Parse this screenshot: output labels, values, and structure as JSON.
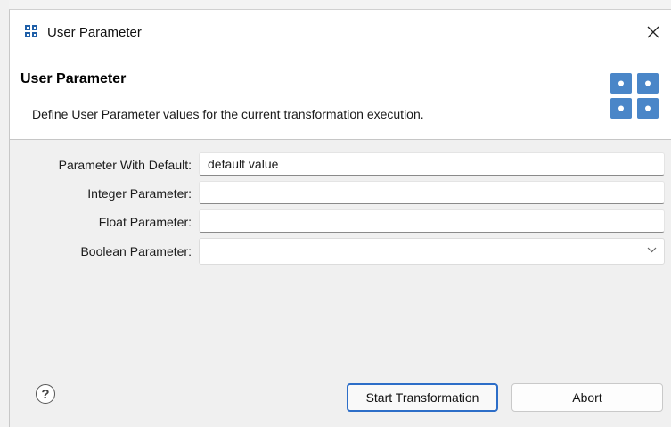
{
  "window": {
    "title": "User Parameter",
    "icon": "grid-app-icon",
    "close_glyph": "✕"
  },
  "banner": {
    "title": "User Parameter",
    "description": "Define User Parameter values for the current transformation execution.",
    "icon": "parameter-grid-icon",
    "accent_color": "#4a86c8"
  },
  "form": {
    "fields": [
      {
        "label": "Parameter With Default:",
        "value": "default value",
        "type": "text"
      },
      {
        "label": "Integer Parameter:",
        "value": "",
        "type": "text"
      },
      {
        "label": "Float Parameter:",
        "value": "",
        "type": "text"
      },
      {
        "label": "Boolean Parameter:",
        "value": "",
        "type": "select"
      }
    ]
  },
  "footer": {
    "help_glyph": "?",
    "start_label": "Start Transformation",
    "abort_label": "Abort"
  }
}
